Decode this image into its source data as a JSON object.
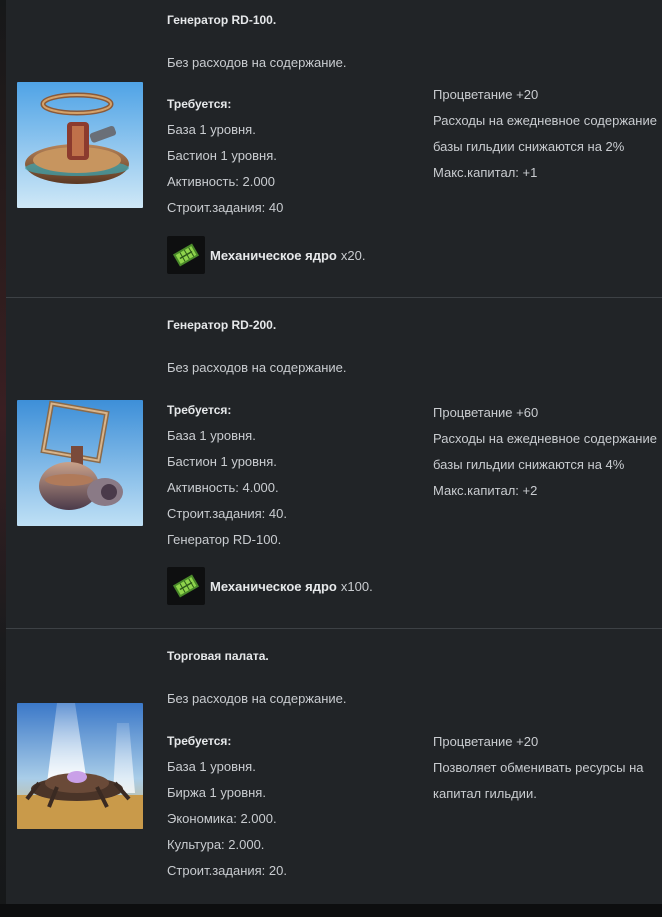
{
  "buildings": [
    {
      "title": "Генератор RD-100.",
      "upkeep": "Без расходов на содержание.",
      "requirements_label": "Требуется:",
      "requirements": [
        "База 1 уровня.",
        "Бастион 1 уровня.",
        "Активность: 2.000",
        "Строит.задания: 40"
      ],
      "bonuses": [
        "Процветание +20",
        "Расходы на ежедневное содержание базы гильдии снижаются на 2%",
        "Макс.капитал: +1"
      ],
      "material": {
        "icon": "mechanical-core-icon",
        "name": "Механическое ядро",
        "qty": "x20."
      }
    },
    {
      "title": "Генератор RD-200.",
      "upkeep": "Без расходов на содержание.",
      "requirements_label": "Требуется:",
      "requirements": [
        "База 1 уровня.",
        "Бастион 1 уровня.",
        "Активность: 4.000.",
        "Строит.задания: 40.",
        "Генератор RD-100."
      ],
      "bonuses": [
        "Процветание +60",
        "Расходы на ежедневное содержание базы гильдии снижаются на 4%",
        "Макс.капитал: +2"
      ],
      "material": {
        "icon": "mechanical-core-icon",
        "name": "Механическое ядро",
        "qty": "x100."
      }
    },
    {
      "title": "Торговая палата.",
      "upkeep": "Без расходов на содержание.",
      "requirements_label": "Требуется:",
      "requirements": [
        "База 1 уровня.",
        "Биржа 1 уровня.",
        "Экономика: 2.000.",
        "Культура: 2.000.",
        "Строит.задания: 20."
      ],
      "bonuses": [
        "Процветание +20",
        "Позволяет обменивать ресурсы на капитал гильдии."
      ]
    }
  ],
  "colors": {
    "background": "#212427",
    "text": "#cfd2d5",
    "separator": "#3d4145"
  }
}
